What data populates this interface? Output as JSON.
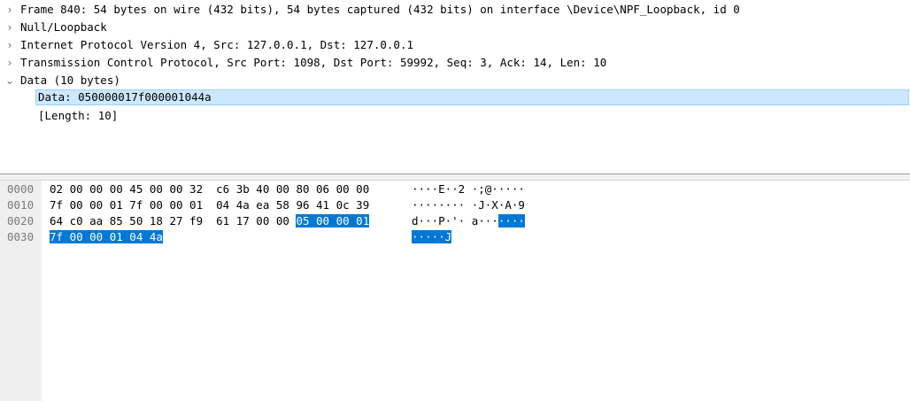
{
  "tree": {
    "rows": [
      {
        "arrow": "›",
        "label": "Frame 840: 54 bytes on wire (432 bits), 54 bytes captured (432 bits) on interface \\Device\\NPF_Loopback, id 0"
      },
      {
        "arrow": "›",
        "label": "Null/Loopback"
      },
      {
        "arrow": "›",
        "label": "Internet Protocol Version 4, Src: 127.0.0.1, Dst: 127.0.0.1"
      },
      {
        "arrow": "›",
        "label": "Transmission Control Protocol, Src Port: 1098, Dst Port: 59992, Seq: 3, Ack: 14, Len: 10"
      },
      {
        "arrow": "⌄",
        "label": "Data (10 bytes)"
      },
      {
        "arrow": "",
        "label": "Data: 050000017f000001044a"
      },
      {
        "arrow": "",
        "label": "[Length: 10]"
      }
    ]
  },
  "bytes": {
    "offsets": [
      "0000",
      "0010",
      "0020",
      "0030"
    ],
    "hex": {
      "r0": "02 00 00 00 45 00 00 32  c6 3b 40 00 80 06 00 00",
      "r1": "7f 00 00 01 7f 00 00 01  04 4a ea 58 96 41 0c 39",
      "r2a": "64 c0 aa 85 50 18 27 f9  61 17 00 00 ",
      "r2b": "05 00 00 01",
      "r3": "7f 00 00 01 04 4a"
    },
    "ascii": {
      "r0": "····E··2 ·;@·····",
      "r1": "········ ·J·X·A·9",
      "r2a": "d···P·'· a···",
      "r2b": "····",
      "r3": "·····J"
    }
  },
  "colors": {
    "selection": "#cce8ff",
    "highlight": "#0078d7"
  }
}
